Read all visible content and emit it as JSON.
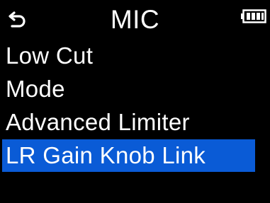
{
  "header": {
    "title": "MIC",
    "back_icon": "return-arrow-icon",
    "battery_icon": "battery-icon"
  },
  "menu": {
    "items": [
      {
        "label": "Low Cut",
        "selected": false
      },
      {
        "label": "Mode",
        "selected": false
      },
      {
        "label": "Advanced Limiter",
        "selected": false
      },
      {
        "label": "LR Gain Knob Link",
        "selected": true
      }
    ]
  },
  "colors": {
    "background": "#000000",
    "text": "#ffffff",
    "selection": "#0a5bd6"
  }
}
